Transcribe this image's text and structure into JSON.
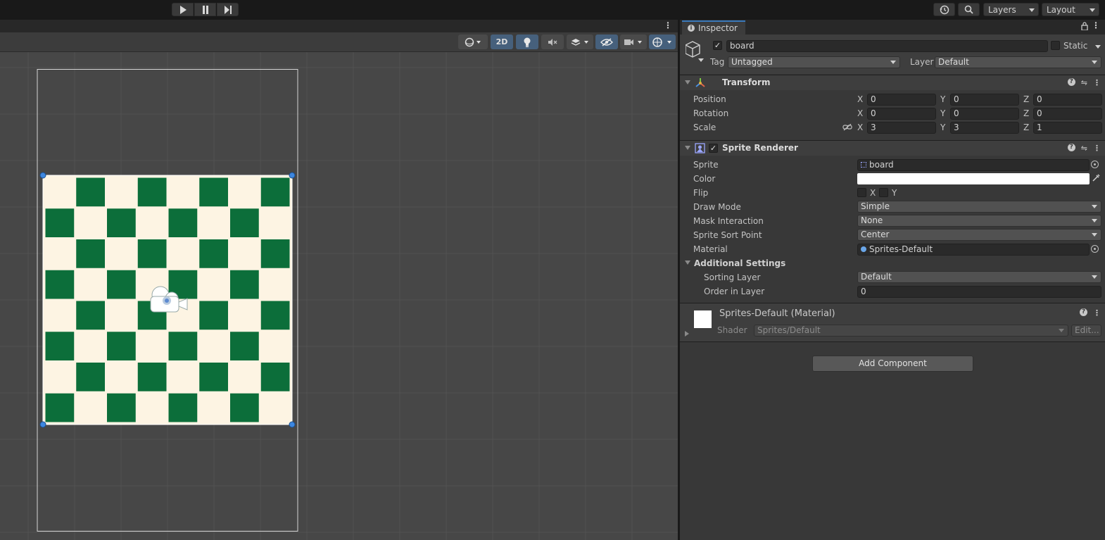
{
  "toolbar": {
    "play_icon": "play-icon",
    "pause_icon": "pause-icon",
    "step_icon": "step-icon",
    "layers_label": "Layers",
    "layout_label": "Layout"
  },
  "scene_toolbar": {
    "mode_2d": "2D"
  },
  "inspector": {
    "tab_label": "Inspector",
    "object": {
      "name": "board",
      "static_label": "Static",
      "tag_label": "Tag",
      "tag_value": "Untagged",
      "layer_label": "Layer",
      "layer_value": "Default"
    },
    "transform": {
      "title": "Transform",
      "position_label": "Position",
      "rotation_label": "Rotation",
      "scale_label": "Scale",
      "position": {
        "x": "0",
        "y": "0",
        "z": "0"
      },
      "rotation": {
        "x": "0",
        "y": "0",
        "z": "0"
      },
      "scale": {
        "x": "3",
        "y": "3",
        "z": "1"
      },
      "axis_x": "X",
      "axis_y": "Y",
      "axis_z": "Z"
    },
    "sprite_renderer": {
      "title": "Sprite Renderer",
      "sprite_label": "Sprite",
      "sprite_value": "board",
      "color_label": "Color",
      "color_value": "#ffffff",
      "flip_label": "Flip",
      "flip_x": "X",
      "flip_y": "Y",
      "draw_mode_label": "Draw Mode",
      "draw_mode_value": "Simple",
      "mask_label": "Mask Interaction",
      "mask_value": "None",
      "sort_point_label": "Sprite Sort Point",
      "sort_point_value": "Center",
      "material_label": "Material",
      "material_value": "Sprites-Default",
      "additional_label": "Additional Settings",
      "sorting_layer_label": "Sorting Layer",
      "sorting_layer_value": "Default",
      "order_label": "Order in Layer",
      "order_value": "0"
    },
    "material": {
      "title": "Sprites-Default (Material)",
      "shader_label": "Shader",
      "shader_value": "Sprites/Default",
      "edit_label": "Edit..."
    },
    "add_component_label": "Add Component"
  },
  "colors": {
    "board_light": "#fdf4e3",
    "board_dark": "#0c6e3a",
    "accent_blue": "#3a79bb"
  }
}
